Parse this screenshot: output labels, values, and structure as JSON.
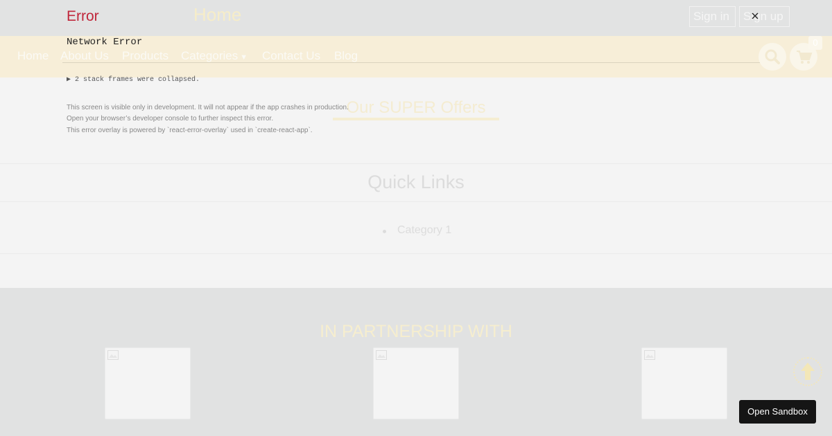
{
  "app": {
    "header": {
      "title": "Home",
      "signin_label": "Sign in",
      "signup_label": "Sign up"
    },
    "nav": {
      "links": [
        "Home",
        "About Us",
        "Products",
        "Categories",
        "Contact Us",
        "Blog"
      ],
      "cart_count": "0"
    },
    "offers": {
      "title": "Our SUPER Offers"
    },
    "quick_links": {
      "title": "Quick Links",
      "items": [
        "Category 1"
      ]
    },
    "partners": {
      "title": "IN PARTNERSHIP WITH"
    }
  },
  "overlay": {
    "title": "Error",
    "message": "Network Error",
    "stack_toggle": "▶ 2 stack frames were collapsed.",
    "notes": [
      "This screen is visible only in development. It will not appear if the app crashes in production.",
      "Open your browser’s developer console to further inspect this error.",
      "This error overlay is powered by `react-error-overlay` used in `create-react-app`."
    ]
  },
  "sandbox": {
    "label": "Open Sandbox"
  },
  "icons": {
    "close": "close-icon",
    "search": "search-icon",
    "cart": "cart-icon",
    "scroll_top": "arrow-up-icon",
    "broken_image": "broken-image-icon"
  },
  "colors": {
    "error_red": "#c0273b",
    "navbar_bg": "#f7eed8",
    "accent_cream": "#f6edc9",
    "sandbox_bg": "#151515"
  }
}
